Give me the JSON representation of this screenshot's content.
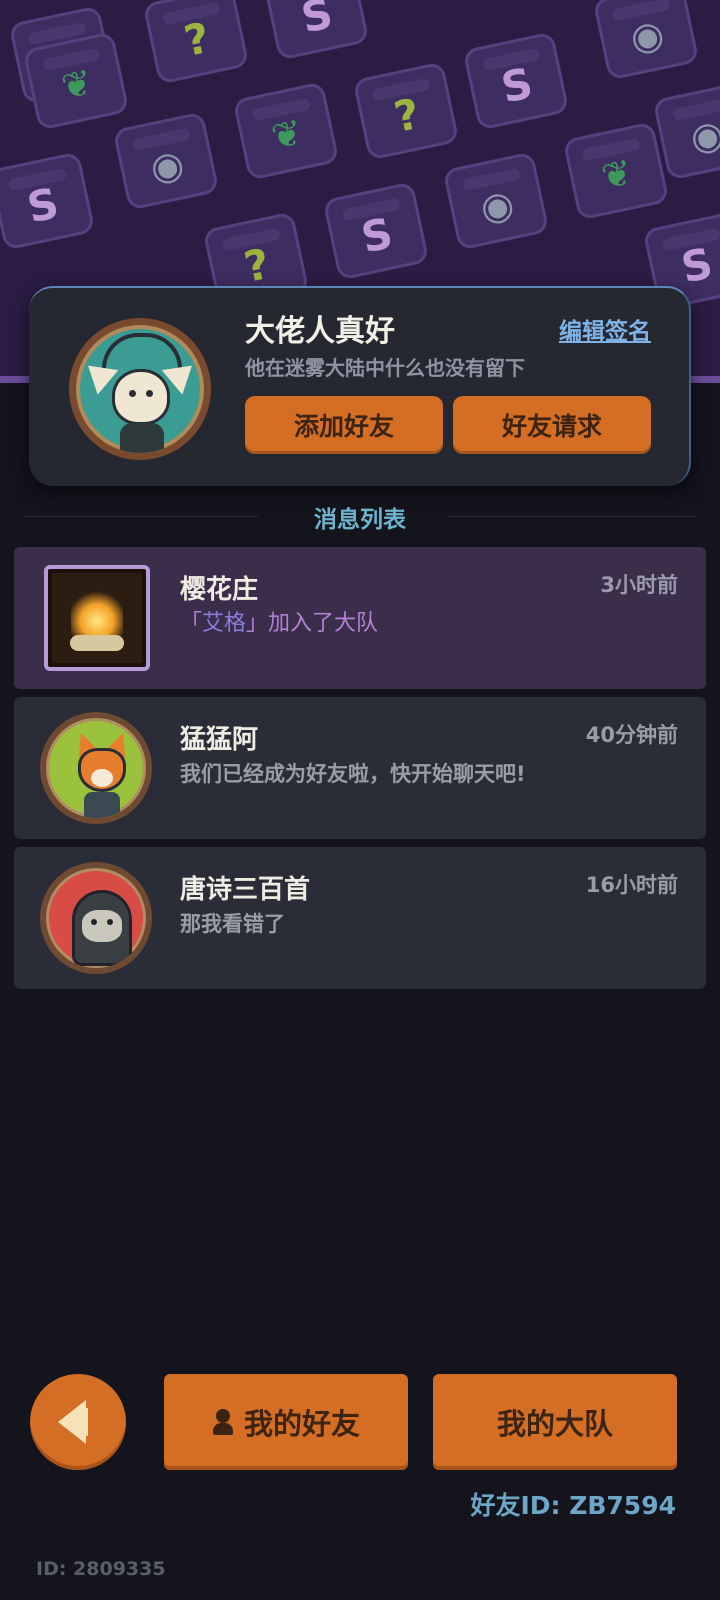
{
  "profile": {
    "name": "大佬人真好",
    "edit_signature_label": "编辑签名",
    "signature": "他在迷雾大陆中什么也没有留下",
    "add_friend_label": "添加好友",
    "friend_requests_label": "好友请求"
  },
  "message_list": {
    "title": "消息列表",
    "items": [
      {
        "name": "樱花庄",
        "time": "3小时前",
        "text_open": "「",
        "text_tag": "艾格",
        "text_close": "」加入了大队",
        "avatar": "campfire-icon",
        "highlighted": true
      },
      {
        "name": "猛猛阿",
        "time": "40分钟前",
        "text": "我们已经成为好友啦，快开始聊天吧!",
        "avatar": "fox-avatar"
      },
      {
        "name": "唐诗三百首",
        "time": "16小时前",
        "text": "那我看错了",
        "avatar": "hooded-cat-avatar"
      }
    ]
  },
  "bottom_bar": {
    "my_friends_label": "我的好友",
    "my_squad_label": "我的大队",
    "friend_id": "好友ID: ZB7594",
    "user_id": "ID: 2809335"
  },
  "banner_icons": [
    "S",
    "?",
    "leaf",
    "eye"
  ],
  "colors": {
    "accent_orange": "#d36e24",
    "background": "#13141c",
    "banner_purple": "#2a1c43",
    "highlight_row": "#3b2e4a",
    "link_blue": "#7fb3e6",
    "section_title": "#6db4cc"
  }
}
